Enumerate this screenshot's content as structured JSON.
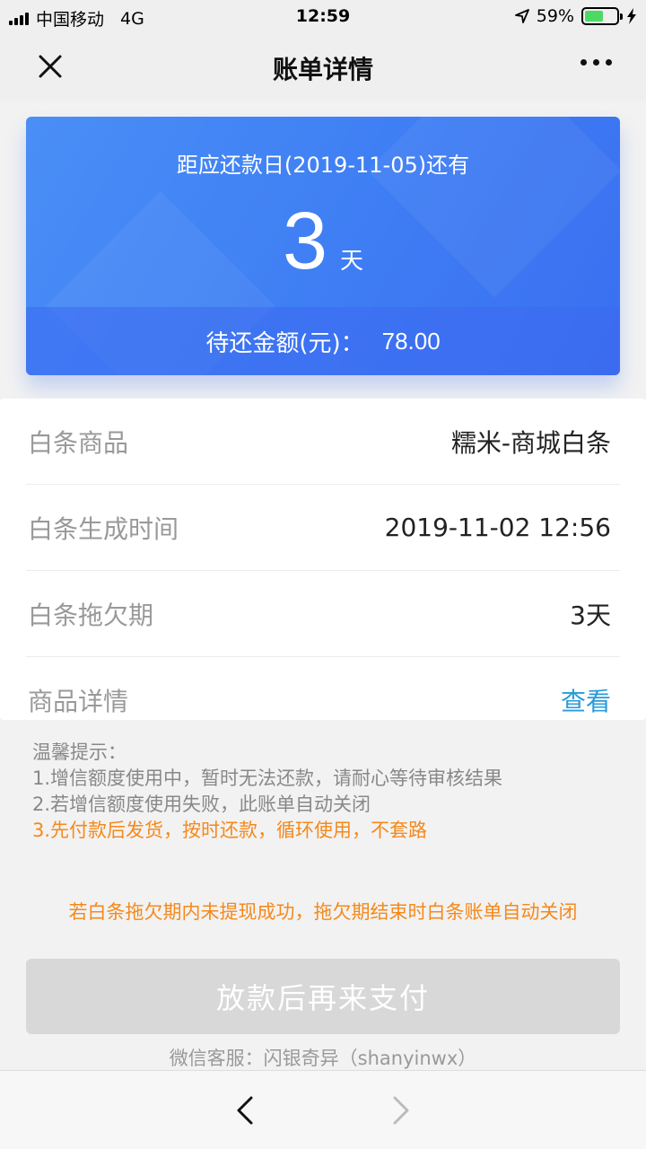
{
  "status_bar": {
    "carrier": "中国移动",
    "network": "4G",
    "time": "12:59",
    "battery_percent": "59%",
    "battery_level": 0.59
  },
  "nav": {
    "title": "账单详情"
  },
  "bill_card": {
    "due_text": "距应还款日(2019-11-05)还有",
    "days": "3",
    "days_unit": "天",
    "amount_label": "待还金额(元)：",
    "amount_value": "78.00"
  },
  "info": {
    "rows": [
      {
        "label": "白条商品",
        "value": "糯米-商城白条"
      },
      {
        "label": "白条生成时间",
        "value": "2019-11-02 12:56"
      },
      {
        "label": "白条拖欠期",
        "value": "3天"
      },
      {
        "label": "商品详情",
        "value": "查看"
      }
    ]
  },
  "tips": {
    "title": "温馨提示：",
    "line1": "1.增信额度使用中，暂时无法还款，请耐心等待审核结果",
    "line2": "2.若增信额度使用失败，此账单自动关闭",
    "line3": "3.先付款后发货，按时还款，循环使用，不套路"
  },
  "notice": "若白条拖欠期内未提现成功，拖欠期结束时白条账单自动关闭",
  "pay_button_label": "放款后再来支付",
  "service_text": "微信客服：闪银奇异（shanyinwx）",
  "colors": {
    "accent_blue": "#3f7ff4",
    "link_blue": "#2a9bd9",
    "warning_orange": "#f5891a",
    "disabled_button": "#d8d8d8"
  }
}
